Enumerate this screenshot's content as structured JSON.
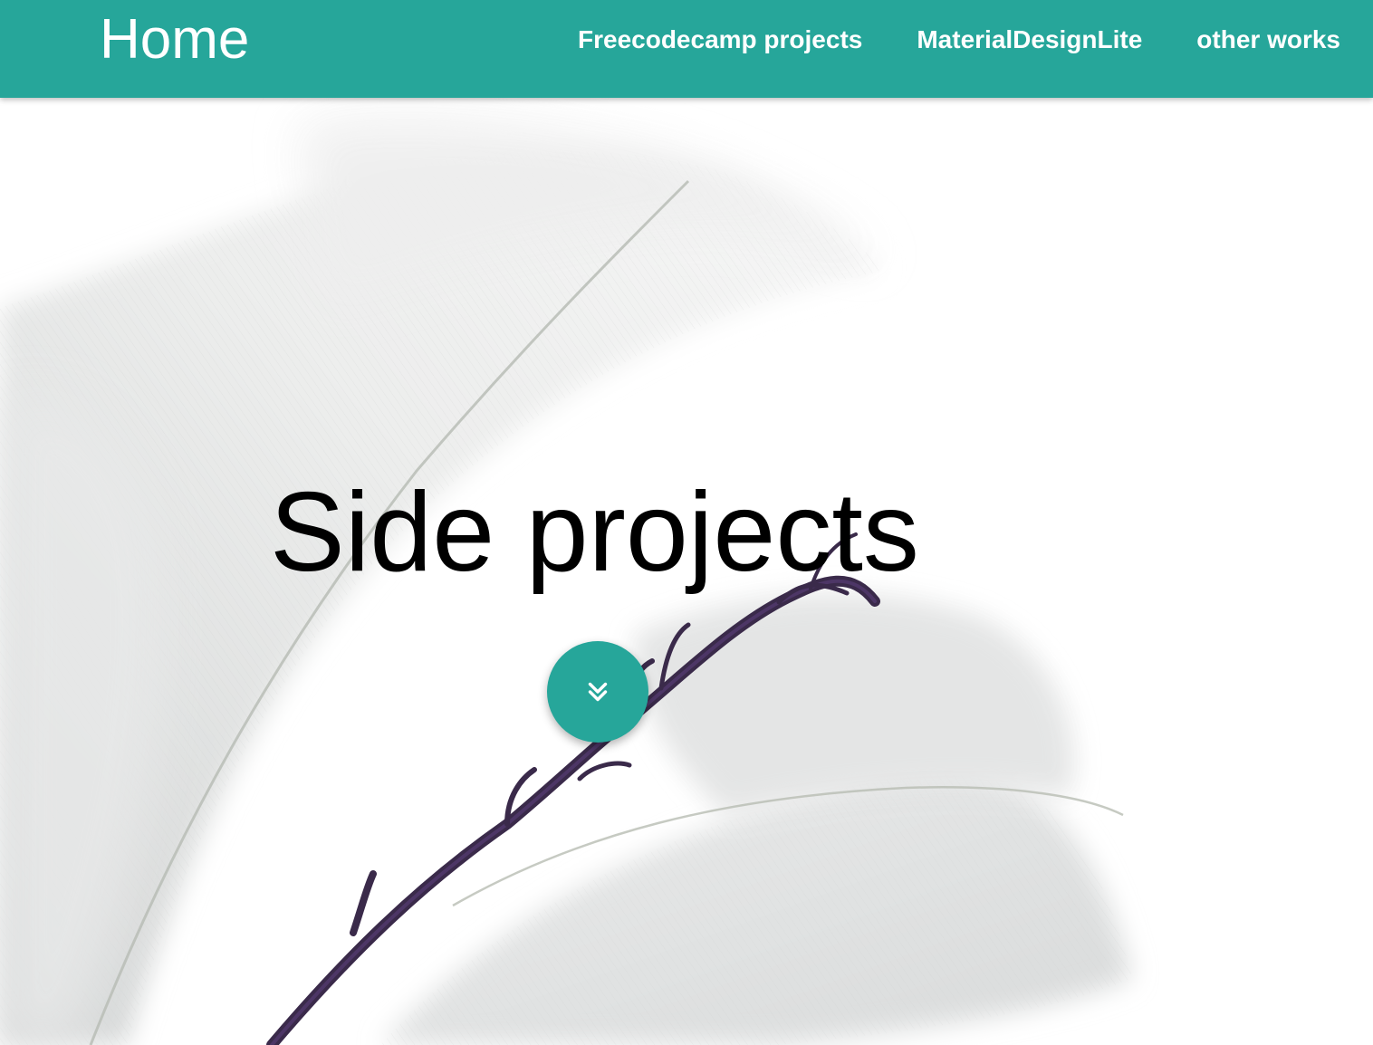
{
  "colors": {
    "accent": "#26a69a",
    "header_text": "#ffffff",
    "title_text": "#000000",
    "background": "#ffffff",
    "branch": "#3a2a4a"
  },
  "header": {
    "brand": "Home",
    "nav": [
      {
        "label": "Freecodecamp projects"
      },
      {
        "label": "MaterialDesignLite"
      },
      {
        "label": "other works"
      }
    ]
  },
  "hero": {
    "title": "Side projects",
    "background_image": "white-feather-with-twig",
    "scroll_button_icon": "double-chevron-down-icon"
  }
}
